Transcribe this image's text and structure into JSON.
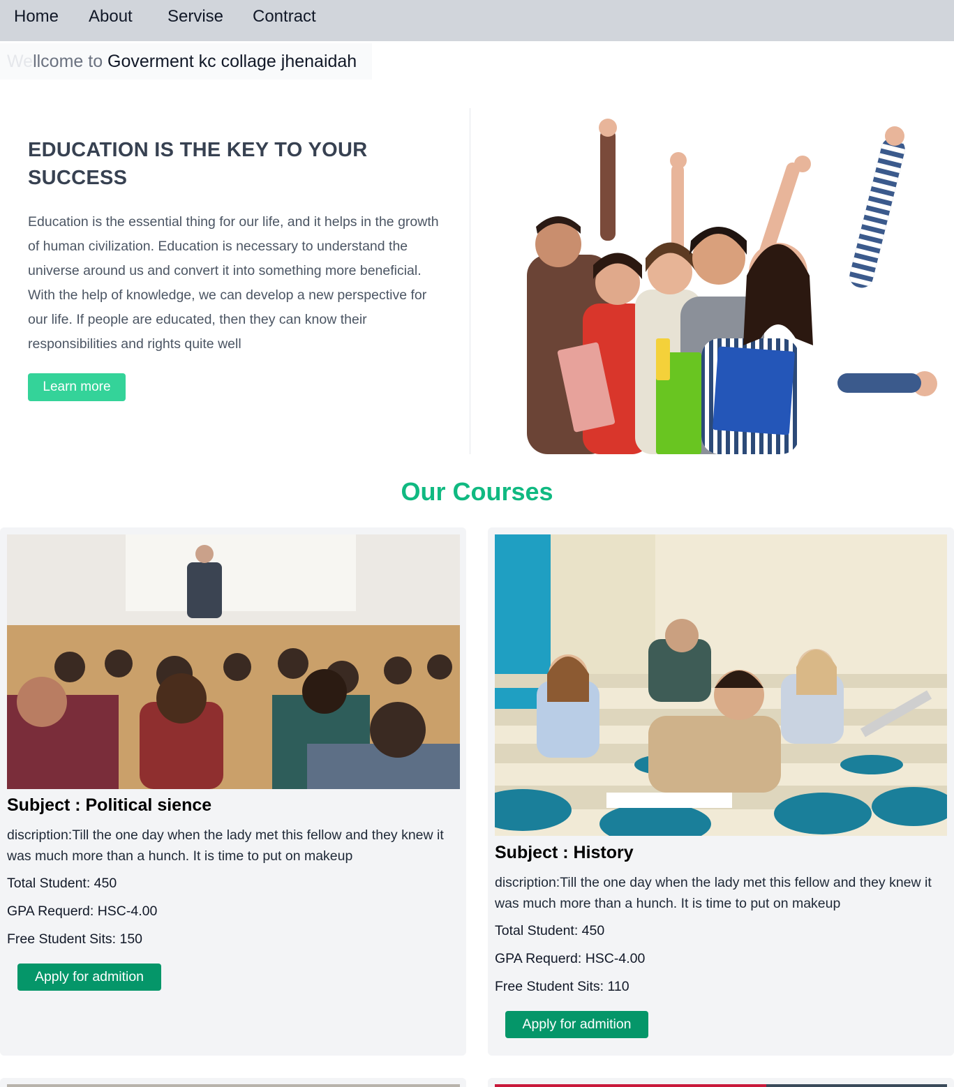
{
  "nav": {
    "items": [
      "Home",
      "About",
      "Servise",
      "Contract"
    ]
  },
  "welcome": {
    "part1": "We",
    "part2": "llcome to",
    "part3": " Goverment kc collage jhenaidah"
  },
  "hero": {
    "title_line1": "EDUCATION IS THE KEY TO YOUR",
    "title_line2": "SUCCESS",
    "paragraph": "Education is the essential thing for our life, and it helps in the growth of human civilization. Education is necessary to understand the universe around us and convert it into something more beneficial. With the help of knowledge, we can develop a new perspective for our life. If people are educated, then they can know their responsibilities and rights quite well",
    "button": "Learn more"
  },
  "courses": {
    "title": "Our Courses",
    "cards": [
      {
        "subject": "Subject : Political sience",
        "description": "discription:Till the one day when the lady met this fellow and they knew it was much more than a hunch. It is time to put on makeup",
        "total_students": "Total Student: 450",
        "gpa": "GPA Requerd: HSC-4.00",
        "free_sits": "Free Student Sits: 150",
        "button": "Apply for admition"
      },
      {
        "subject": "Subject : History",
        "description": "discription:Till the one day when the lady met this fellow and they knew it was much more than a hunch. It is time to put on makeup",
        "total_students": "Total Student: 450",
        "gpa": "GPA Requerd: HSC-4.00",
        "free_sits": "Free Student Sits: 110",
        "button": "Apply for admition"
      }
    ]
  },
  "colors": {
    "nav_bg": "#d1d5db",
    "accent_green": "#10b981",
    "learn_button": "#34d399",
    "apply_button": "#059669",
    "card_bg": "#f3f4f6"
  }
}
